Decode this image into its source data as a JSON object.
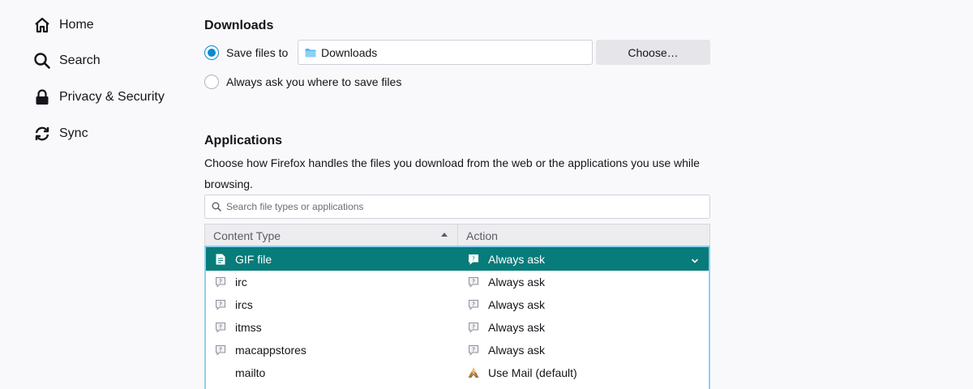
{
  "sidebar": {
    "items": [
      {
        "label": "Home",
        "icon": "home-icon"
      },
      {
        "label": "Search",
        "icon": "search-icon"
      },
      {
        "label": "Privacy & Security",
        "icon": "lock-icon"
      },
      {
        "label": "Sync",
        "icon": "sync-icon"
      }
    ]
  },
  "downloads": {
    "title": "Downloads",
    "save_files_label": "Save files to",
    "save_path": "Downloads",
    "choose_label": "Choose…",
    "always_ask_label": "Always ask you where to save files",
    "selected_option": "save_files"
  },
  "applications": {
    "title": "Applications",
    "description": "Choose how Firefox handles the files you download from the web or the applications you use while browsing.",
    "search_placeholder": "Search file types or applications",
    "columns": {
      "content_type": "Content Type",
      "action": "Action"
    },
    "rows": [
      {
        "type": "GIF file",
        "action": "Always ask",
        "type_icon": "file-icon",
        "action_icon": "ask-icon",
        "selected": true
      },
      {
        "type": "irc",
        "action": "Always ask",
        "type_icon": "ask-icon",
        "action_icon": "ask-icon"
      },
      {
        "type": "ircs",
        "action": "Always ask",
        "type_icon": "ask-icon",
        "action_icon": "ask-icon"
      },
      {
        "type": "itmss",
        "action": "Always ask",
        "type_icon": "ask-icon",
        "action_icon": "ask-icon"
      },
      {
        "type": "macappstores",
        "action": "Always ask",
        "type_icon": "ask-icon",
        "action_icon": "ask-icon"
      },
      {
        "type": "mailto",
        "action": "Use Mail (default)",
        "type_icon": "",
        "action_icon": "mail-app-icon"
      }
    ]
  },
  "colors": {
    "accent": "#0b89d1",
    "selected_row": "#077c7a"
  }
}
